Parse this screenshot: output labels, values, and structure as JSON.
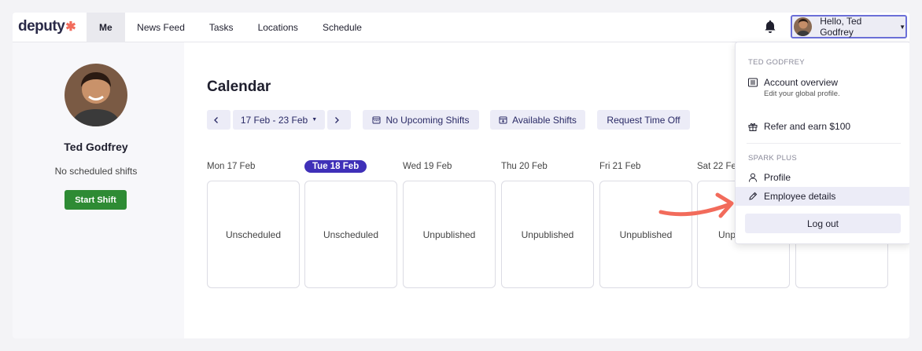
{
  "brand": {
    "name": "deputy",
    "accent_color": "#f26b5b"
  },
  "nav": {
    "items": [
      {
        "label": "Me",
        "active": true
      },
      {
        "label": "News Feed",
        "active": false
      },
      {
        "label": "Tasks",
        "active": false
      },
      {
        "label": "Locations",
        "active": false
      },
      {
        "label": "Schedule",
        "active": false
      }
    ]
  },
  "header": {
    "notification_icon": "bell-icon",
    "user_greeting": "Hello, Ted Godfrey"
  },
  "sidebar": {
    "name": "Ted Godfrey",
    "status": "No scheduled shifts",
    "start_button": "Start Shift",
    "start_button_color": "#2e8b34"
  },
  "calendar": {
    "title": "Calendar",
    "date_range": "17 Feb - 23 Feb",
    "no_upcoming": "No Upcoming Shifts",
    "available": "Available Shifts",
    "request_time_off": "Request Time Off",
    "days": [
      {
        "label": "Mon 17 Feb",
        "status": "Unscheduled",
        "today": false
      },
      {
        "label": "Tue 18 Feb",
        "status": "Unscheduled",
        "today": true
      },
      {
        "label": "Wed 19 Feb",
        "status": "Unpublished",
        "today": false
      },
      {
        "label": "Thu 20 Feb",
        "status": "Unpublished",
        "today": false
      },
      {
        "label": "Fri 21 Feb",
        "status": "Unpublished",
        "today": false
      },
      {
        "label": "Sat 22 Feb",
        "status": "Unp",
        "today": false
      }
    ],
    "today_color": "#3f30b8"
  },
  "dropdown": {
    "section1": "TED GODFREY",
    "account_overview": "Account overview",
    "account_overview_sub": "Edit your global profile.",
    "refer": "Refer and earn $100",
    "section2": "SPARK PLUS",
    "profile": "Profile",
    "employee_details": "Employee details",
    "logout": "Log out"
  },
  "annotation_arrow_color": "#f26b5b"
}
